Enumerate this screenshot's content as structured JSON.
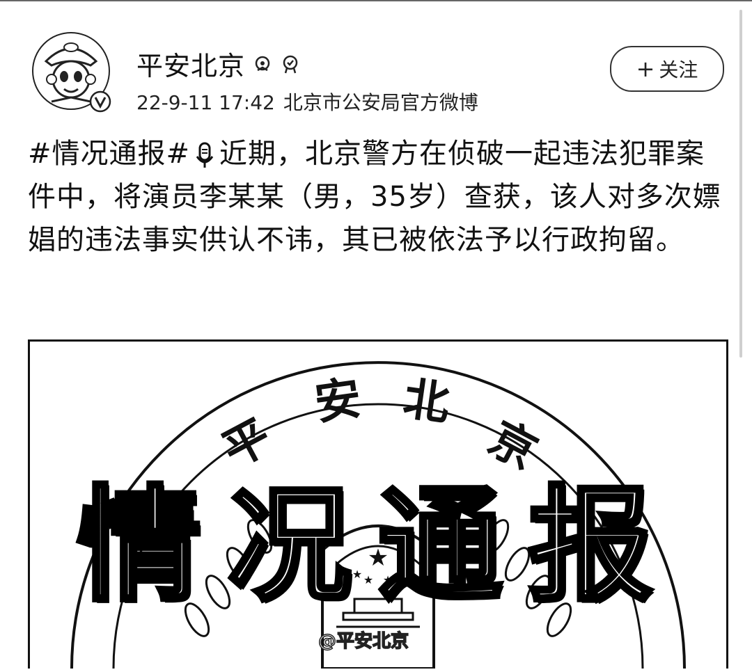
{
  "account": {
    "name": "平安北京",
    "time": "22-9-11 17:42",
    "source": "北京市公安局官方微博"
  },
  "follow_button": {
    "icon": "plus",
    "label": "关注"
  },
  "post": {
    "hashtag": "#情况通报#",
    "body": "近期，北京警方在侦破一起违法犯罪案件中，将演员李某某（男，35岁）查获，该人对多次嫖娼的违法事实供认不讳，其已被依法予以行政拘留。"
  },
  "image": {
    "arc_text": [
      "平",
      "安",
      "北",
      "京"
    ],
    "title": "情况通报",
    "watermark": "@平安北京"
  }
}
